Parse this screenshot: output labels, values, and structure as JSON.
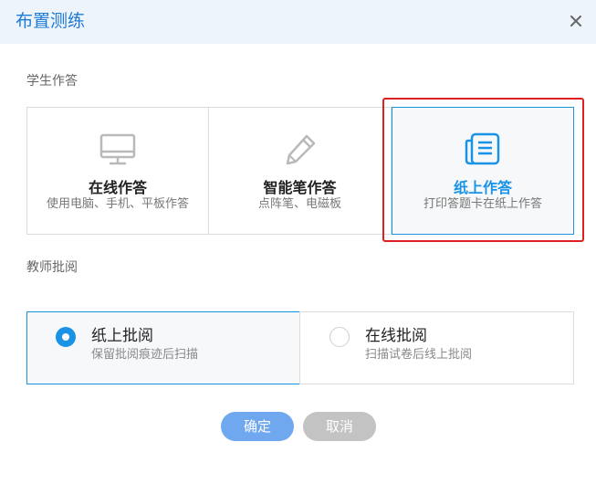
{
  "dialog": {
    "title": "布置测练",
    "close_icon": "close-icon"
  },
  "student_section": {
    "label": "学生作答",
    "options": [
      {
        "title": "在线作答",
        "subtitle": "使用电脑、手机、平板作答",
        "icon": "monitor-icon",
        "selected": false
      },
      {
        "title": "智能笔作答",
        "subtitle": "点阵笔、电磁板",
        "icon": "pen-icon",
        "selected": false
      },
      {
        "title": "纸上作答",
        "subtitle": "打印答题卡在纸上作答",
        "icon": "paper-document-icon",
        "selected": true
      }
    ]
  },
  "teacher_section": {
    "label": "教师批阅",
    "options": [
      {
        "title": "纸上批阅",
        "subtitle": "保留批阅痕迹后扫描",
        "selected": true
      },
      {
        "title": "在线批阅",
        "subtitle": "扫描试卷后线上批阅",
        "selected": false
      }
    ]
  },
  "footer": {
    "confirm_label": "确定",
    "cancel_label": "取消"
  },
  "colors": {
    "accent": "#1a93e6",
    "title": "#1f7ad6",
    "header_bg": "#eef4fc",
    "confirm_bg": "#6fa8ef",
    "cancel_bg": "#c3c3c3",
    "highlight": "#e02020"
  }
}
